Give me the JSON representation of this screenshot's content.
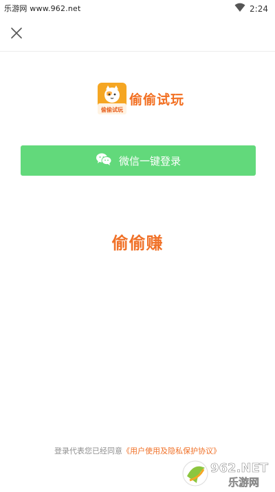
{
  "status_bar": {
    "source_text": "乐游网 www.962.net",
    "time": "2:24",
    "wifi_icon": "wifi-icon"
  },
  "header": {
    "close_icon": "close-icon"
  },
  "brand": {
    "logo_icon": "app-logo-icon",
    "logo_tile_text": "偷偷试玩",
    "name": "偷偷试玩",
    "accent_color": "#f26f21"
  },
  "login": {
    "wechat_button_label": "微信一键登录",
    "wechat_icon": "wechat-icon",
    "button_color": "#62d97b"
  },
  "slogan": "偷偷赚",
  "agreement": {
    "prefix": "登录代表您已经同意",
    "link_text": "《用户使用及隐私保护协议》"
  },
  "watermark": {
    "top_text": "962.NET",
    "bottom_text": "乐游网"
  }
}
